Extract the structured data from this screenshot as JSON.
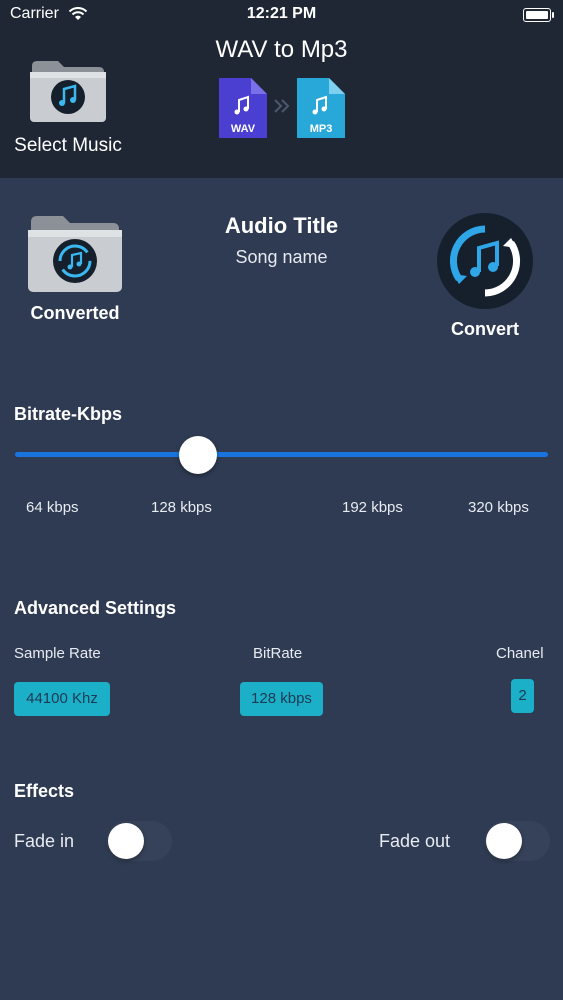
{
  "status_bar": {
    "carrier": "Carrier",
    "time": "12:21 PM"
  },
  "header": {
    "title": "WAV to Mp3",
    "select_music_label": "Select Music",
    "from_format": "WAV",
    "to_format": "MP3"
  },
  "audio": {
    "title": "Audio Title",
    "song_name": "Song name"
  },
  "actions": {
    "converted_label": "Converted",
    "convert_label": "Convert"
  },
  "bitrate": {
    "title": "Bitrate-Kbps",
    "ticks": [
      "64 kbps",
      "128 kbps",
      "192 kbps",
      "320 kbps"
    ]
  },
  "advanced": {
    "title": "Advanced Settings",
    "sample_rate": {
      "label": "Sample Rate",
      "value": "44100 Khz"
    },
    "bitrate": {
      "label": "BitRate",
      "value": "128 kbps"
    },
    "channel": {
      "label": "Chanel",
      "value": "2"
    }
  },
  "effects": {
    "title": "Effects",
    "fade_in": {
      "label": "Fade in",
      "on": false
    },
    "fade_out": {
      "label": "Fade out",
      "on": false
    }
  },
  "colors": {
    "background": "#2e3b52",
    "header_bg": "#1f2735",
    "slider_accent": "#1a74e0",
    "chip": "#1cb0c8",
    "wav_icon": "#4a3fd0",
    "mp3_icon": "#27a8d8"
  },
  "icons": {
    "select_music": "music-folder-icon",
    "converted": "converted-folder-icon",
    "convert": "convert-music-icon"
  }
}
